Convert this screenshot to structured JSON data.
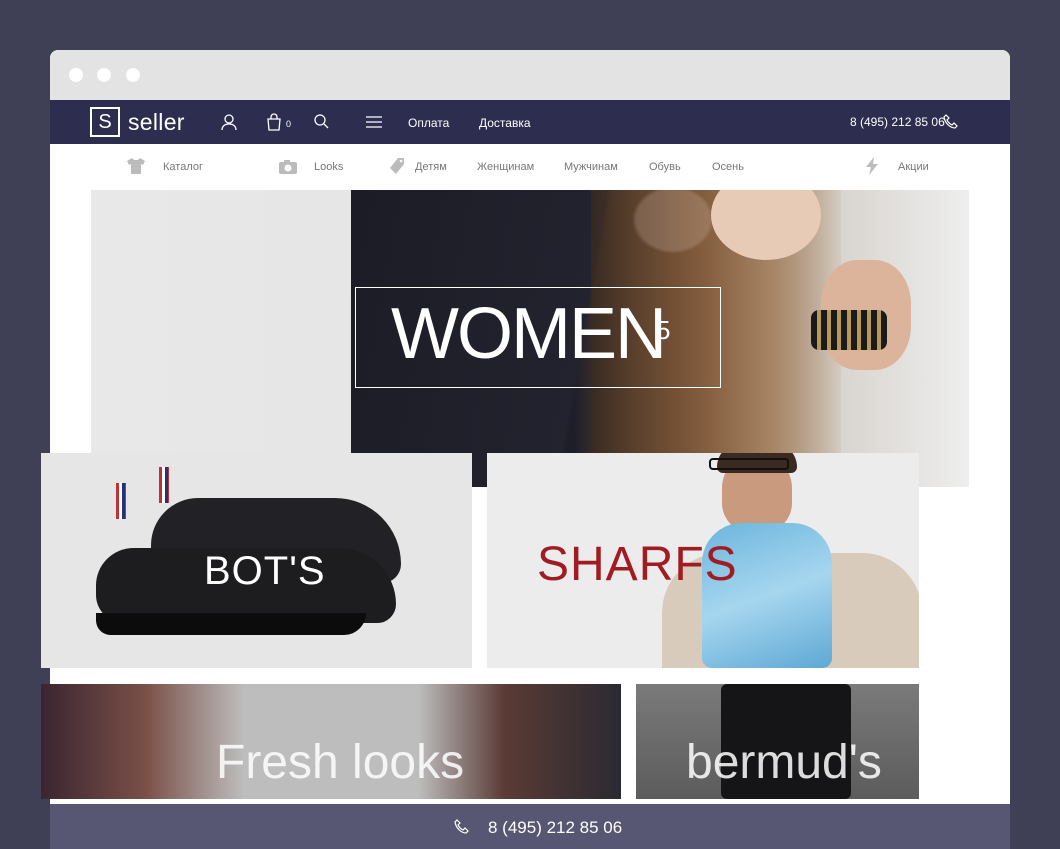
{
  "header": {
    "logo_letter": "S",
    "logo_text": "seller",
    "cart_count": "0",
    "links": [
      "Оплата",
      "Доставка"
    ],
    "phone": "8 (495) 212 85 06"
  },
  "categories": {
    "items": [
      "Каталог",
      "Looks",
      "Детям",
      "Женщинам",
      "Мужчинам",
      "Обувь",
      "Осень",
      "Акции"
    ]
  },
  "hero": {
    "title": "WOMEN",
    "superscript": "5",
    "slides": 2,
    "active_slide": 2
  },
  "tiles": {
    "bots": "BOT'S",
    "sharfs": "SHARFS",
    "fresh": "Fresh looks",
    "bermuds": "bermud's"
  },
  "footer_bar": {
    "phone": "8 (495) 212 85 06"
  },
  "colors": {
    "background": "#3f3f56",
    "topbar": "#2d2d50",
    "sharfs_text": "#a01c22",
    "bottom_bar": "#3a3a5c"
  },
  "icons": [
    "user-icon",
    "cart-icon",
    "search-icon",
    "menu-icon",
    "phone-icon",
    "tshirt-icon",
    "camera-icon",
    "tag-icon",
    "lightning-icon"
  ]
}
